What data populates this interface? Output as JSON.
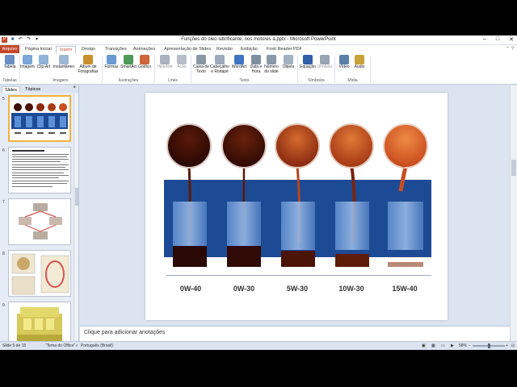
{
  "window": {
    "title": "Funções do óleo lubrificante, nos motores a.pptx - Microsoft PowerPoint",
    "controls": [
      "–",
      "□",
      "✕"
    ]
  },
  "tabs": [
    {
      "label": "Arquivo",
      "style": "file"
    },
    {
      "label": "Página Inicial",
      "style": ""
    },
    {
      "label": "Inserir",
      "style": "active"
    },
    {
      "label": "Design",
      "style": ""
    },
    {
      "label": "Transições",
      "style": ""
    },
    {
      "label": "Animações",
      "style": ""
    },
    {
      "label": "Apresentação de Slides",
      "style": ""
    },
    {
      "label": "Revisão",
      "style": ""
    },
    {
      "label": "Exibição",
      "style": ""
    },
    {
      "label": "Foxit Reader PDF",
      "style": ""
    }
  ],
  "ribbon": {
    "buttons": [
      {
        "label": "Tabela",
        "icon": "table-icon",
        "color": "#6b8fc4",
        "disabled": false
      },
      {
        "label": "Imagem",
        "icon": "picture-icon",
        "color": "#7aa7d8",
        "disabled": false
      },
      {
        "label": "Clip-Art",
        "icon": "clipart-icon",
        "color": "#8fb3d9",
        "disabled": false
      },
      {
        "label": "Instantâneo",
        "icon": "screenshot-icon",
        "color": "#9fb7d4",
        "disabled": false
      },
      {
        "label": "Álbum de Fotografias",
        "icon": "photo-album-icon",
        "color": "#c9902f",
        "disabled": false
      },
      {
        "label": "Formas",
        "icon": "shapes-icon",
        "color": "#6c9ad0",
        "disabled": false
      },
      {
        "label": "SmartArt",
        "icon": "smartart-icon",
        "color": "#4f9a5a",
        "disabled": false
      },
      {
        "label": "Gráfico",
        "icon": "chart-icon",
        "color": "#d0643a",
        "disabled": false
      },
      {
        "label": "Hiperlink",
        "icon": "hyperlink-icon",
        "color": "#a9b2be",
        "disabled": true
      },
      {
        "label": "Ação",
        "icon": "action-icon",
        "color": "#b8bec7",
        "disabled": true
      },
      {
        "label": "Caixa de Texto",
        "icon": "textbox-icon",
        "color": "#8a95a5",
        "disabled": false
      },
      {
        "label": "Cabeçalho e Rodapé",
        "icon": "header-footer-icon",
        "color": "#9eaab8",
        "disabled": false
      },
      {
        "label": "WordArt",
        "icon": "wordart-icon",
        "color": "#3e74c2",
        "disabled": false
      },
      {
        "label": "Data e Hora",
        "icon": "datetime-icon",
        "color": "#7f8da0",
        "disabled": false
      },
      {
        "label": "Número do slide",
        "icon": "slide-number-icon",
        "color": "#8a97a8",
        "disabled": false
      },
      {
        "label": "Objeto",
        "icon": "object-icon",
        "color": "#a3b0c0",
        "disabled": false
      },
      {
        "label": "Equação",
        "icon": "equation-icon",
        "color": "#2f5fa8",
        "disabled": false
      },
      {
        "label": "Símbolo",
        "icon": "symbol-icon",
        "color": "#9aa5b3",
        "disabled": true
      },
      {
        "label": "Vídeo",
        "icon": "video-icon",
        "color": "#5a7fa8",
        "disabled": false
      },
      {
        "label": "Áudio",
        "icon": "audio-icon",
        "color": "#c9a23a",
        "disabled": false
      }
    ],
    "groups": [
      "Tabelas",
      "Imagens",
      "Ilustrações",
      "Links",
      "Texto",
      "Símbolos",
      "Mídia"
    ]
  },
  "pane": {
    "tabs": [
      "Slides",
      "Tópicos"
    ],
    "close": "×",
    "thumbnails": [
      {
        "number": "5"
      },
      {
        "number": "6"
      },
      {
        "number": "7"
      },
      {
        "number": "8"
      },
      {
        "number": "9"
      }
    ]
  },
  "slide": {
    "oil_grades": [
      "0W-40",
      "0W-30",
      "5W-30",
      "10W-30",
      "15W-40"
    ],
    "colors": {
      "backdrop": "#1d4a95",
      "oil_dark": "#3a0d05",
      "oil_mid": "#8a2a10",
      "oil_light": "#c94d1f"
    }
  },
  "notes": {
    "placeholder": "Clique para adicionar anotações"
  },
  "status": {
    "slide": "Slide 5 de 15",
    "theme": "\"Tema do Office\"",
    "language": "Português (Brasil)",
    "zoom": "58%"
  }
}
